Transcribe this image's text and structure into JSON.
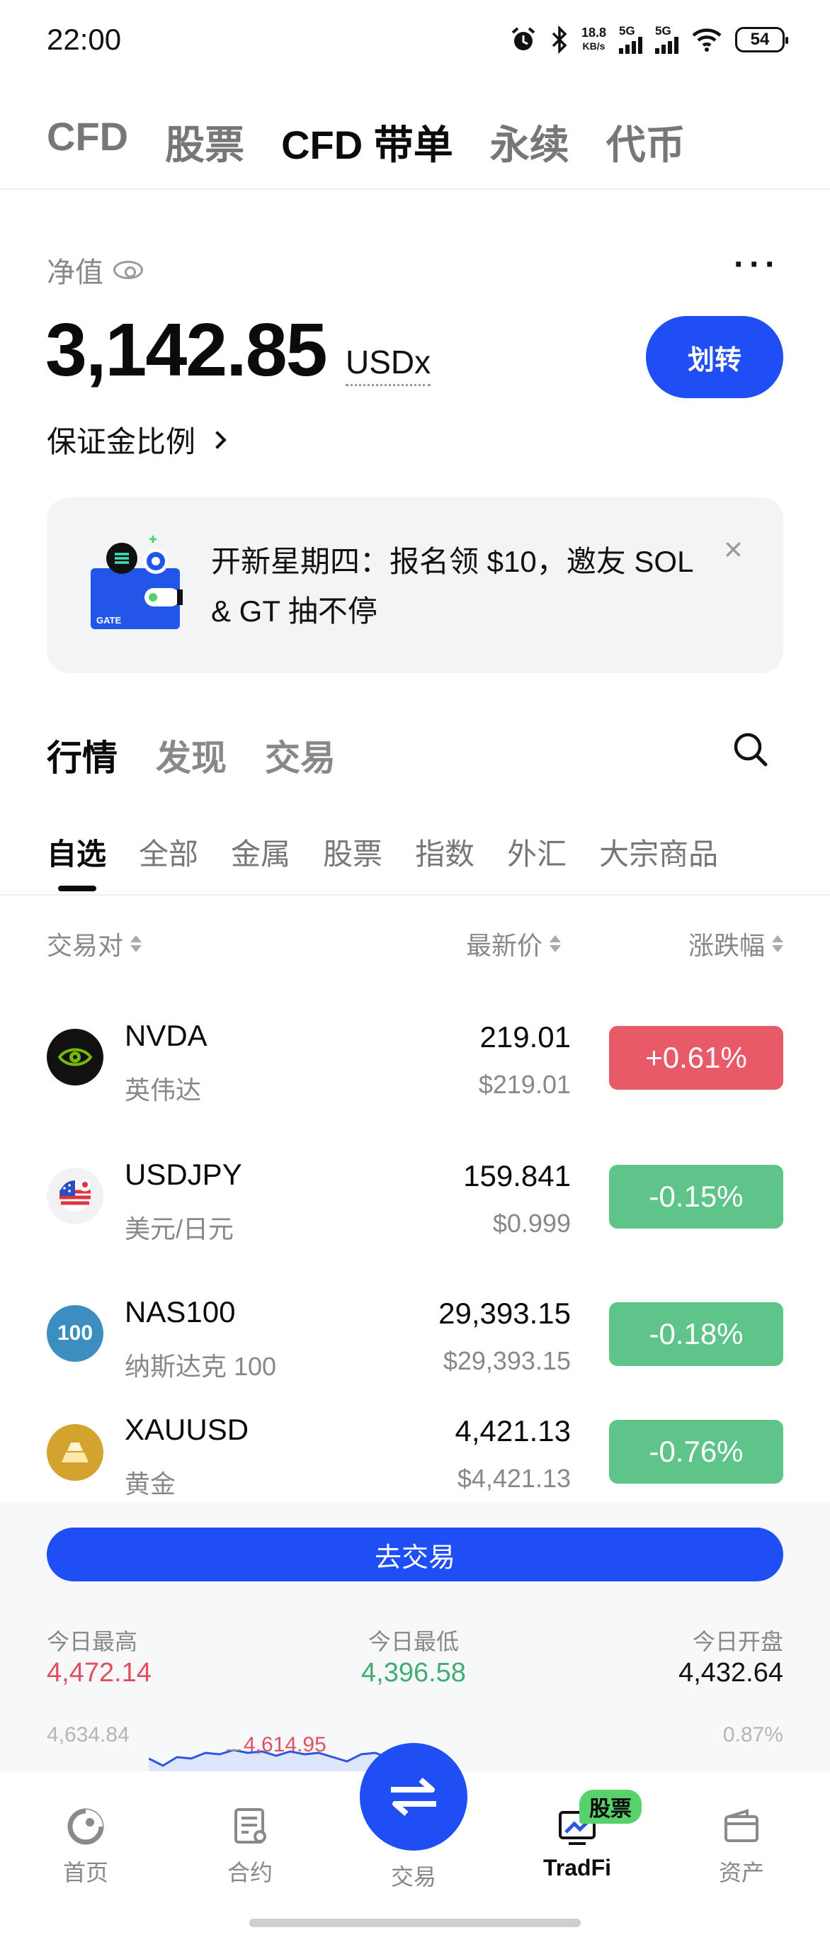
{
  "status_bar": {
    "time": "22:00",
    "net_speed_value": "18.8",
    "net_speed_unit": "KB/s",
    "sim1": "5G",
    "sim2": "5G",
    "battery": "54",
    "icons": [
      "alarm-icon",
      "bluetooth-icon",
      "signal-icon",
      "wifi-icon",
      "battery-icon"
    ]
  },
  "top_tabs": [
    {
      "label": "CFD",
      "active": false
    },
    {
      "label": "股票",
      "active": false
    },
    {
      "label": "CFD 带单",
      "active": true
    },
    {
      "label": "永续",
      "active": false
    },
    {
      "label": "代币",
      "active": false
    }
  ],
  "account": {
    "equity_label": "净值",
    "equity_value": "3,142.85",
    "equity_unit": "USDx",
    "transfer_label": "划转",
    "margin_ratio_label": "保证金比例",
    "more_label": "···"
  },
  "banner": {
    "text": "开新星期四：报名领 $10，邀友 SOL & GT 抽不停",
    "art_label": "GATE",
    "close_label": "×"
  },
  "section_tabs": [
    {
      "label": "行情",
      "active": true
    },
    {
      "label": "发现",
      "active": false
    },
    {
      "label": "交易",
      "active": false
    }
  ],
  "category_tabs": [
    {
      "label": "自选",
      "active": true
    },
    {
      "label": "全部",
      "active": false
    },
    {
      "label": "金属",
      "active": false
    },
    {
      "label": "股票",
      "active": false
    },
    {
      "label": "指数",
      "active": false
    },
    {
      "label": "外汇",
      "active": false
    },
    {
      "label": "大宗商品",
      "active": false
    }
  ],
  "table": {
    "headers": {
      "pair": "交易对",
      "price": "最新价",
      "change": "涨跌幅"
    },
    "rows": [
      {
        "symbol": "NVDA",
        "name": "英伟达",
        "price": "219.01",
        "usd": "$219.01",
        "change": "+0.61%",
        "direction": "up",
        "logo": "nvidia-icon"
      },
      {
        "symbol": "USDJPY",
        "name": "美元/日元",
        "price": "159.841",
        "usd": "$0.999",
        "change": "-0.15%",
        "direction": "down",
        "logo": "us-flag-icon"
      },
      {
        "symbol": "NAS100",
        "name": "纳斯达克 100",
        "price": "29,393.15",
        "usd": "$29,393.15",
        "change": "-0.18%",
        "direction": "down",
        "logo": "nas100-icon",
        "logo_text": "100"
      },
      {
        "symbol": "XAUUSD",
        "name": "黄金",
        "price": "4,421.13",
        "usd": "$4,421.13",
        "change": "-0.76%",
        "direction": "down",
        "logo": "gold-bar-icon"
      }
    ]
  },
  "detail": {
    "go_trade_label": "去交易",
    "high_label": "今日最高",
    "high_value": "4,472.14",
    "low_label": "今日最低",
    "low_value": "4,396.58",
    "open_label": "今日开盘",
    "open_value": "4,432.64",
    "axis_left_top": "4,634.84",
    "axis_right_top": "0.87%",
    "chart_marker": "4,614.95"
  },
  "bottom_nav": {
    "items": [
      {
        "label": "首页",
        "icon": "home-icon",
        "active": false
      },
      {
        "label": "合约",
        "icon": "contract-icon",
        "active": false
      },
      {
        "label": "交易",
        "icon": "swap-icon",
        "active": false
      },
      {
        "label": "TradFi",
        "icon": "tradfi-icon",
        "active": true
      },
      {
        "label": "资产",
        "icon": "wallet-icon",
        "active": false
      }
    ],
    "tradfi_badge": "股票"
  },
  "colors": {
    "brand_blue": "#1f4ef5",
    "up_red": "#e85a68",
    "down_green": "#5ec48a",
    "badge_green": "#56d16b"
  }
}
